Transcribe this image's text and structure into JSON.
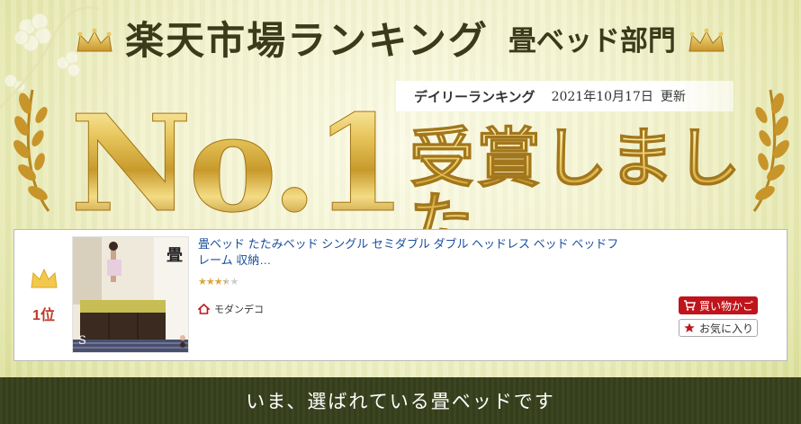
{
  "banner": {
    "title": "楽天市場ランキング",
    "category": "畳ベッド部門",
    "ranking_type": "デイリーランキング",
    "date": "2021年10月17日",
    "update_label": "更新",
    "no1": "No.1",
    "award": "受賞しました"
  },
  "product": {
    "rank": "1位",
    "title": "畳ベッド たたみベッド シングル セミダブル ダブル ヘッドレス ベッド ベッドフレーム 収納…",
    "rating": 3.5,
    "stars_text_on": "★★★",
    "stars_text_half": "★",
    "stars_text_off": "★",
    "shop": "モダンデコ",
    "thumb_label": "畳",
    "thumb_letter": "S",
    "cart_button": "買い物かご",
    "fav_button": "お気に入り"
  },
  "footer": {
    "tagline": "いま、選ばれている畳ベッドです"
  },
  "colors": {
    "gold": "#c89a2c",
    "title_dark": "#3b3b1c",
    "link_blue": "#1a4f9a",
    "cart_red": "#c0141c",
    "bottom_bar": "#3c4521"
  }
}
